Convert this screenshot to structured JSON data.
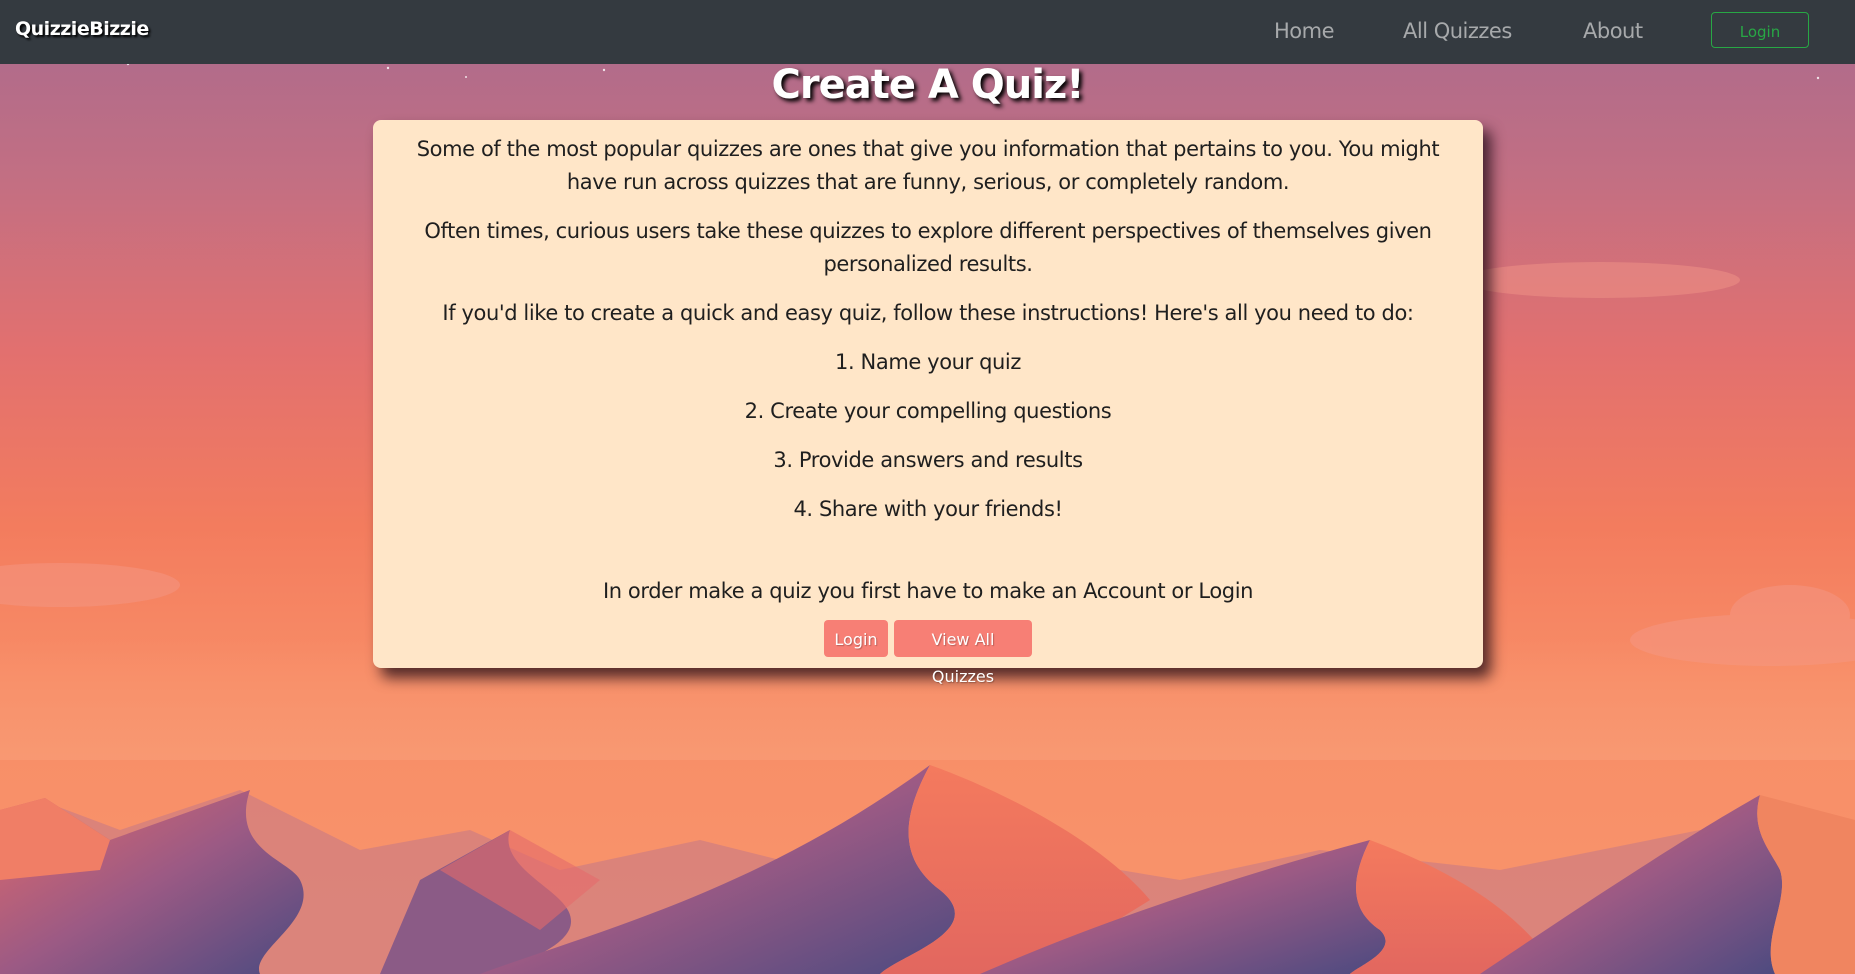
{
  "navbar": {
    "brand": "QuizzieBizzie",
    "links": {
      "home": "Home",
      "all_quizzes": "All Quizzes",
      "about": "About"
    },
    "login_label": "Login"
  },
  "page": {
    "title": "Create A Quiz!"
  },
  "card": {
    "intro": "Some of the most popular quizzes are ones that give you information that pertains to you. You might have run across quizzes that are funny, serious, or completely random.",
    "perspective": "Often times, curious users take these quizzes to explore different perspectives of themselves given personalized results.",
    "instructions_lead": "If you'd like to create a quick and easy quiz, follow these instructions! Here's all you need to do:",
    "steps": [
      "1. Name your quiz",
      "2. Create your compelling questions",
      "3. Provide answers and results",
      "4. Share with your friends!"
    ],
    "account_note": "In order make a quiz you first have to make an Account or Login",
    "buttons": {
      "login": "Login",
      "view_all": "View All Quizzes"
    }
  },
  "colors": {
    "navbar_bg": "#343a40",
    "card_bg": "#ffe6c8",
    "button_bg": "#f77f75",
    "nav_login_border": "#28a745"
  }
}
